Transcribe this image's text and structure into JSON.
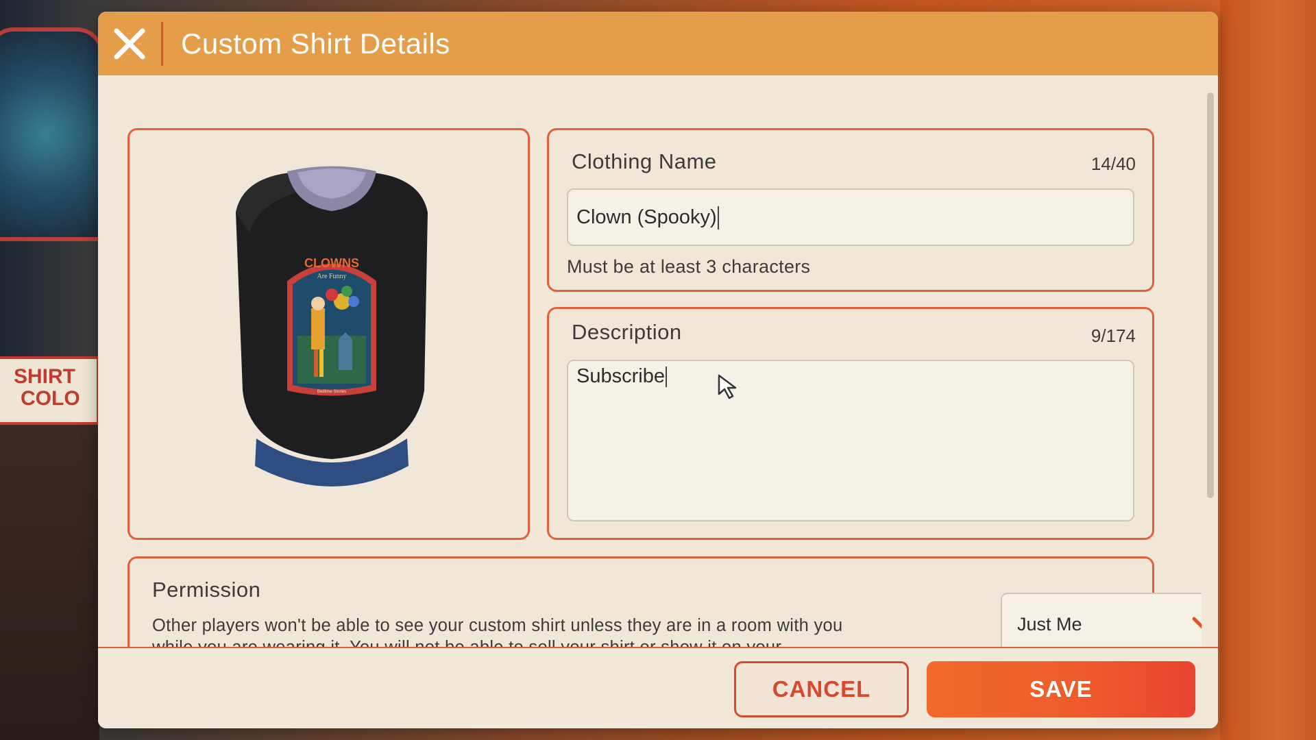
{
  "background": {
    "sign_line1": "SHIRT",
    "sign_line2": "COLO"
  },
  "dialog": {
    "title": "Custom Shirt Details",
    "close_icon": "close-icon"
  },
  "preview": {
    "shirt_graphic_title": "CLOWNS",
    "shirt_graphic_subtitle": "Are Funny",
    "shirt_graphic_footer": "Bedtime Stories"
  },
  "clothing_name": {
    "label": "Clothing Name",
    "counter": "14/40",
    "value": "Clown (Spooky)",
    "helper": "Must be at least 3 characters"
  },
  "description": {
    "label": "Description",
    "counter": "9/174",
    "value": "Subscribe"
  },
  "permission": {
    "label": "Permission",
    "text": "Other players won't be able to see your custom shirt unless they are in a room with you while you are wearing it. You will not be able to sell your shirt or show it on your",
    "selected": "Just Me"
  },
  "footer": {
    "cancel_label": "CANCEL",
    "save_label": "SAVE"
  },
  "colors": {
    "header": "#e49e4a",
    "accent": "#e2603a",
    "panel_bg": "#f2e8d9",
    "save_button": "#ee5a2c"
  }
}
